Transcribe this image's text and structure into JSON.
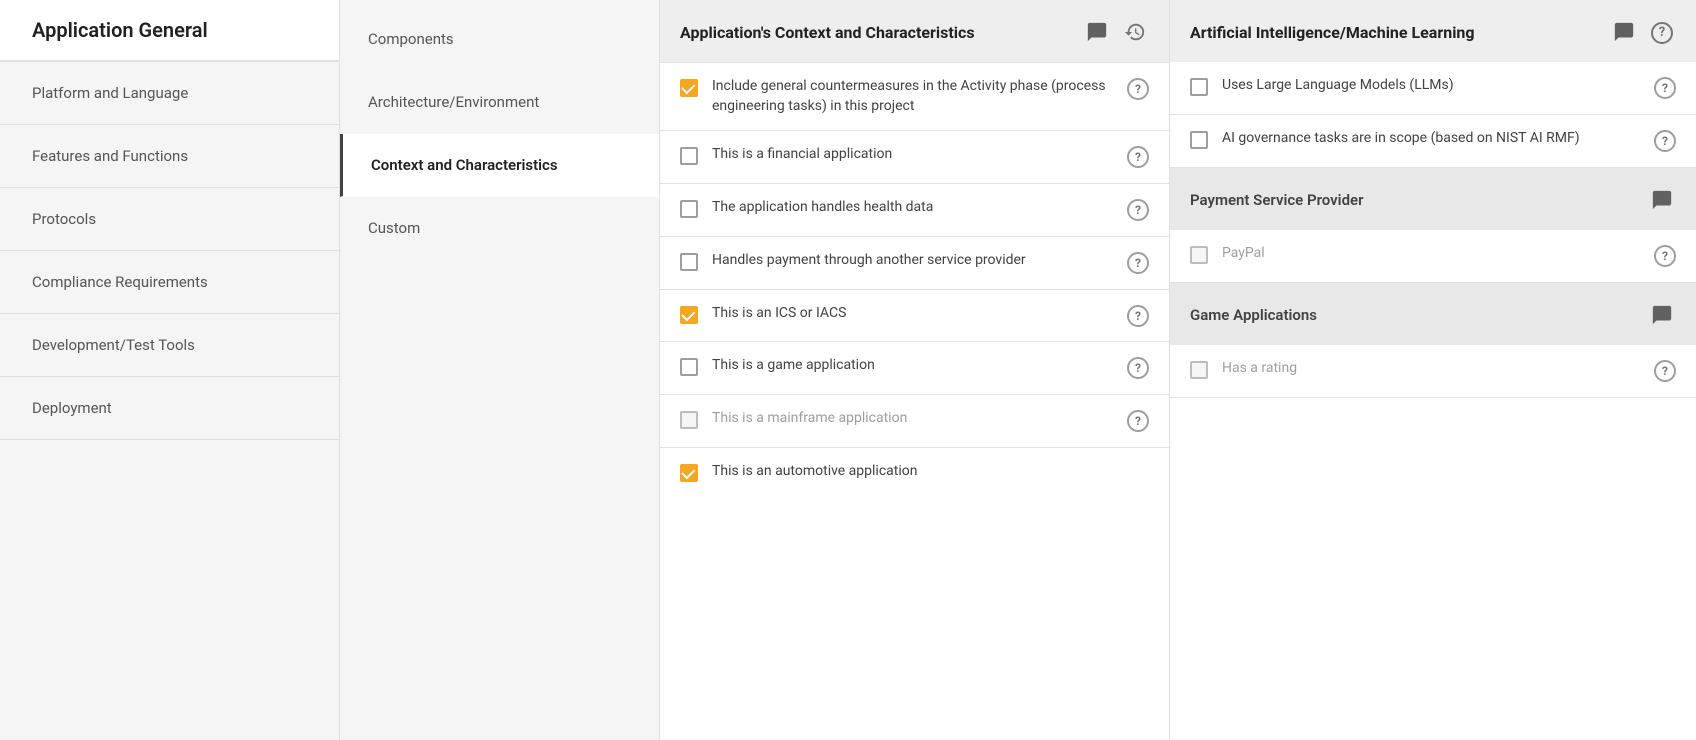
{
  "nav": {
    "header": "Application General",
    "items": [
      {
        "label": "Platform and Language",
        "id": "platform"
      },
      {
        "label": "Features and Functions",
        "id": "features"
      },
      {
        "label": "Protocols",
        "id": "protocols"
      },
      {
        "label": "Compliance Requirements",
        "id": "compliance"
      },
      {
        "label": "Development/Test Tools",
        "id": "devtools"
      },
      {
        "label": "Deployment",
        "id": "deployment"
      }
    ]
  },
  "subnav": {
    "items": [
      {
        "label": "Components",
        "id": "components",
        "active": false
      },
      {
        "label": "Architecture/Environment",
        "id": "arch",
        "active": false
      },
      {
        "label": "Context and Characteristics",
        "id": "context",
        "active": true
      },
      {
        "label": "Custom",
        "id": "custom",
        "active": false
      }
    ]
  },
  "context_section": {
    "title": "Application's Context and\nCharacteristics",
    "items": [
      {
        "id": "countermeasures",
        "label": "Include general countermeasures in the Activity phase (process engineering tasks) in this project",
        "checked": true,
        "disabled": false
      },
      {
        "id": "financial",
        "label": "This is a financial application",
        "checked": false,
        "disabled": false
      },
      {
        "id": "health",
        "label": "The application handles health data",
        "checked": false,
        "disabled": false
      },
      {
        "id": "payment",
        "label": "Handles payment through another service provider",
        "checked": false,
        "disabled": false
      },
      {
        "id": "ics",
        "label": "This is an ICS or IACS",
        "checked": true,
        "disabled": false
      },
      {
        "id": "game",
        "label": "This is a game application",
        "checked": false,
        "disabled": false
      },
      {
        "id": "mainframe",
        "label": "This is a mainframe application",
        "checked": false,
        "disabled": true
      },
      {
        "id": "automotive",
        "label": "This is an automotive application",
        "checked": true,
        "disabled": false
      }
    ]
  },
  "ai_section": {
    "title": "Artificial Intelligence/Machine\nLearning",
    "items": [
      {
        "id": "llm",
        "label": "Uses Large Language Models (LLMs)",
        "checked": false,
        "disabled": false
      },
      {
        "id": "governance",
        "label": "AI governance tasks are in scope (based on NIST AI RMF)",
        "checked": false,
        "disabled": false
      }
    ]
  },
  "payment_provider_section": {
    "title": "Payment Service Provider",
    "items": [
      {
        "id": "paypal",
        "label": "PayPal",
        "checked": false,
        "disabled": true
      }
    ]
  },
  "game_applications_section": {
    "title": "Game Applications",
    "items": [
      {
        "id": "rating",
        "label": "Has a rating",
        "checked": false,
        "disabled": true
      }
    ]
  },
  "icons": {
    "chat": "💬",
    "history": "↺",
    "help": "?",
    "check": "✓"
  }
}
